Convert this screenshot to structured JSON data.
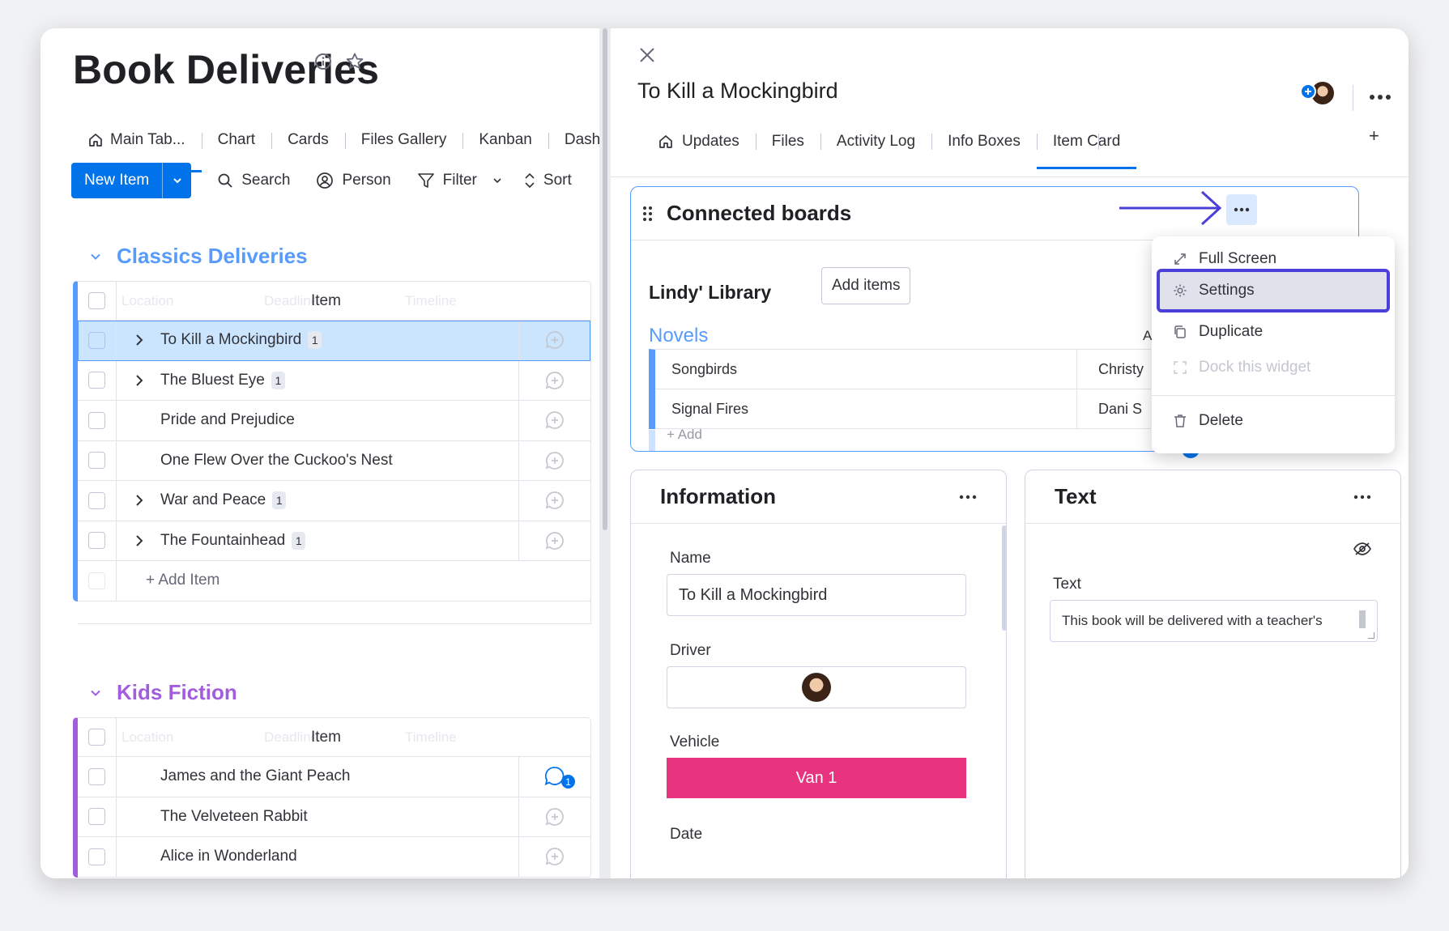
{
  "board": {
    "title": "Book Deliveries",
    "tabs": [
      {
        "label": "Main Tab..."
      },
      {
        "label": "Chart"
      },
      {
        "label": "Cards"
      },
      {
        "label": "Files Gallery"
      },
      {
        "label": "Kanban"
      },
      {
        "label": "Dash"
      }
    ],
    "toolbar": {
      "new_item": "New Item",
      "search": "Search",
      "person": "Person",
      "filter": "Filter",
      "sort": "Sort"
    },
    "column_headers": {
      "location": "Location",
      "deadline": "Deadline",
      "item": "Item",
      "timeline": "Timeline"
    },
    "groups": [
      {
        "title": "Classics Deliveries",
        "color": "#579bfc",
        "items": [
          {
            "name": "To Kill a Mockingbird",
            "badge": "1"
          },
          {
            "name": "The Bluest Eye",
            "badge": "1"
          },
          {
            "name": "Pride and Prejudice",
            "badge": ""
          },
          {
            "name": "One Flew Over the Cuckoo's Nest",
            "badge": ""
          },
          {
            "name": "War and Peace",
            "badge": "1"
          },
          {
            "name": "The Fountainhead",
            "badge": "1"
          }
        ],
        "add_item": "+ Add Item"
      },
      {
        "title": "Kids Fiction",
        "color": "#a25ddc",
        "items": [
          {
            "name": "James and the Giant Peach",
            "update_count": "1"
          },
          {
            "name": "The Velveteen Rabbit"
          },
          {
            "name": "Alice in Wonderland"
          }
        ]
      }
    ]
  },
  "item_panel": {
    "title": "To Kill a Mockingbird",
    "tabs": [
      {
        "label": "Updates"
      },
      {
        "label": "Files"
      },
      {
        "label": "Activity Log"
      },
      {
        "label": "Info Boxes"
      },
      {
        "label": "Item Card"
      }
    ],
    "add_tab": "+",
    "connected_boards": {
      "title": "Connected boards",
      "board_name": "Lindy' Library",
      "add_items": "Add items",
      "group_name": "Novels",
      "rows": [
        {
          "name": "Songbirds",
          "author": "Christy"
        },
        {
          "name": "Signal Fires",
          "author": "Dani S"
        }
      ],
      "col_letter": "A",
      "add": "+ Add"
    },
    "menu": {
      "items": [
        {
          "label": "Full Screen"
        },
        {
          "label": "Settings"
        },
        {
          "label": "Duplicate"
        },
        {
          "label": "Dock this widget"
        },
        {
          "label": "Delete"
        }
      ]
    },
    "information": {
      "title": "Information",
      "name_label": "Name",
      "name_value": "To Kill a Mockingbird",
      "driver_label": "Driver",
      "vehicle_label": "Vehicle",
      "vehicle_value": "Van 1",
      "vehicle_color": "#e8347f",
      "date_label": "Date"
    },
    "text_widget": {
      "title": "Text",
      "field_label": "Text",
      "field_value": "This book will be delivered with a teacher's"
    }
  },
  "colors": {
    "primary": "#0073ea",
    "annotation": "#4a3fd6"
  }
}
